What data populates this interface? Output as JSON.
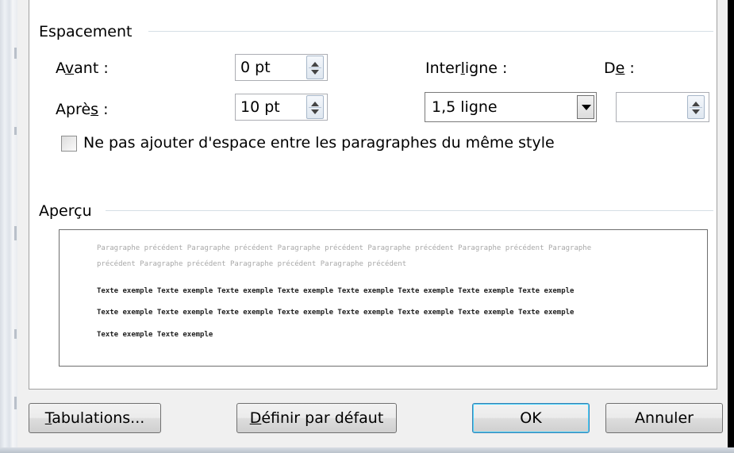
{
  "spacing": {
    "group_title": "Espacement",
    "before_label_pre": "A",
    "before_label_acc": "v",
    "before_label_post": "ant :",
    "before_value": "0 pt",
    "after_label_pre": "Aprè",
    "after_label_acc": "s",
    "after_label_post": " :",
    "after_value": "10 pt",
    "line_spacing_label_pre": "Inter",
    "line_spacing_label_acc": "l",
    "line_spacing_label_post": "igne :",
    "line_spacing_value": "1,5 ligne",
    "at_label_pre": "D",
    "at_label_acc": "e",
    "at_label_post": " :",
    "at_value": "",
    "no_space_checkbox_pre": "Ne pas a",
    "no_space_checkbox_acc": "j",
    "no_space_checkbox_post": "outer d'espace entre les paragraphes du même style",
    "no_space_checked": false
  },
  "preview": {
    "group_title": "Aperçu",
    "previous_para_lines": [
      "Paragraphe précédent Paragraphe précédent Paragraphe précédent Paragraphe précédent Paragraphe précédent Paragraphe",
      "précédent Paragraphe précédent Paragraphe précédent Paragraphe précédent"
    ],
    "sample_lines": [
      "Texte exemple Texte exemple Texte exemple Texte exemple Texte exemple Texte exemple Texte exemple Texte exemple",
      "Texte exemple Texte exemple Texte exemple Texte exemple Texte exemple Texte exemple Texte exemple Texte exemple",
      "Texte exemple Texte exemple"
    ]
  },
  "buttons": {
    "tabs_acc": "T",
    "tabs_post": "abulations...",
    "default_acc": "D",
    "default_post": "éfinir par défaut",
    "ok": "OK",
    "cancel": "Annuler"
  }
}
